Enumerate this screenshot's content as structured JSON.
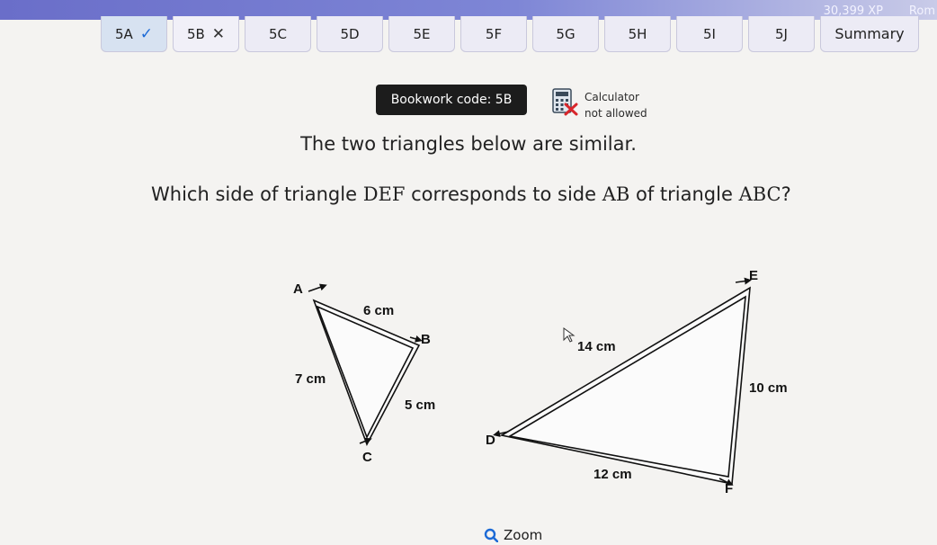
{
  "header": {
    "xp": "30,399 XP",
    "user": "Rom"
  },
  "tabs": [
    {
      "label": "5A",
      "status": "correct"
    },
    {
      "label": "5B",
      "status": "incorrect"
    },
    {
      "label": "5C",
      "status": ""
    },
    {
      "label": "5D",
      "status": ""
    },
    {
      "label": "5E",
      "status": ""
    },
    {
      "label": "5F",
      "status": ""
    },
    {
      "label": "5G",
      "status": ""
    },
    {
      "label": "5H",
      "status": ""
    },
    {
      "label": "5I",
      "status": ""
    },
    {
      "label": "5J",
      "status": ""
    },
    {
      "label": "Summary",
      "status": ""
    }
  ],
  "bookwork": {
    "label": "Bookwork code: 5B"
  },
  "calculator": {
    "line1": "Calculator",
    "line2": "not allowed",
    "icon": "calculator-crossed-icon"
  },
  "question": {
    "intro": "The two triangles below are similar.",
    "prompt_before": "Which side of triangle ",
    "triangle1": "DEF",
    "prompt_middle": " corresponds to side ",
    "side": "AB",
    "prompt_after": " of triangle ",
    "triangle2": "ABC",
    "prompt_end": "?"
  },
  "triangle_abc": {
    "vertices": [
      "A",
      "B",
      "C"
    ],
    "sides": {
      "ab": "6 cm",
      "ac": "7 cm",
      "bc": "5 cm"
    }
  },
  "triangle_def": {
    "vertices": [
      "D",
      "E",
      "F"
    ],
    "sides": {
      "de": "14 cm",
      "ef": "10 cm",
      "df": "12 cm"
    }
  },
  "zoom": {
    "label": "Zoom",
    "icon": "magnifier-icon"
  },
  "colors": {
    "accent": "#1c6ad6",
    "header": "#6a6ec9",
    "bookwork_bg": "#1c1c1c"
  }
}
